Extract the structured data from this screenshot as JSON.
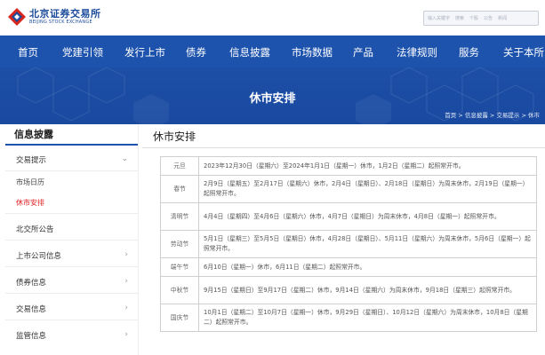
{
  "header": {
    "logo_cn": "北京证券交易所",
    "logo_en": "BEIJING STOCK EXCHANGE",
    "search_hints": [
      "输入关键字",
      "搜索",
      "个股",
      "公告",
      "新闻"
    ]
  },
  "nav": {
    "items": [
      "首页",
      "党建引领",
      "发行上市",
      "债券",
      "信息披露",
      "市场数据",
      "产品",
      "法律规则",
      "服务",
      "关于本所"
    ]
  },
  "banner": {
    "title": "休市安排",
    "breadcrumb": "首页 > 信息披露 > 交易提示 > 休市"
  },
  "sidebar": {
    "title": "信息披露",
    "items": [
      {
        "label": "交易提示",
        "arrow": "⌄"
      },
      {
        "label": "市场日历"
      },
      {
        "label": "休市安排",
        "active": true
      },
      {
        "label": "北交所公告"
      },
      {
        "label": "上市公司信息",
        "arrow": "›"
      },
      {
        "label": "债券信息",
        "arrow": "›"
      },
      {
        "label": "交易信息",
        "arrow": "›"
      },
      {
        "label": "监管信息",
        "arrow": "›"
      }
    ]
  },
  "main": {
    "title": "休市安排",
    "rows": [
      {
        "holiday": "元旦",
        "text": "2023年12月30日（星期六）至2024年1月1日（星期一）休市，1月2日（星期二）起照常开市。"
      },
      {
        "holiday": "春节",
        "text": "2月9日（星期五）至2月17日（星期六）休市，2月4日（星期日）、2月18日（星期日）为周末休市，2月19日（星期一）起照常开市。"
      },
      {
        "holiday": "清明节",
        "text": "4月4日（星期四）至4月6日（星期六）休市，4月7日（星期日）为周末休市，4月8日（星期一）起照常开市。"
      },
      {
        "holiday": "劳动节",
        "text": "5月1日（星期三）至5月5日（星期日）休市，4月28日（星期日）、5月11日（星期六）为周末休市，5月6日（星期一）起照常开市。"
      },
      {
        "holiday": "端午节",
        "text": "6月10日（星期一）休市，6月11日（星期二）起照常开市。"
      },
      {
        "holiday": "中秋节",
        "text": "9月15日（星期日）至9月17日（星期二）休市，9月14日（星期六）为周末休市，9月18日（星期三）起照常开市。"
      },
      {
        "holiday": "国庆节",
        "text": "10月1日（星期二）至10月7日（星期一）休市，9月29日（星期日）、10月12日（星期六）为周末休市，10月8日（星期二）起照常开市。"
      }
    ]
  },
  "colors": {
    "brand_blue": "#1d53ad",
    "active_red": "#e02020",
    "logo_red": "#d9261c"
  }
}
